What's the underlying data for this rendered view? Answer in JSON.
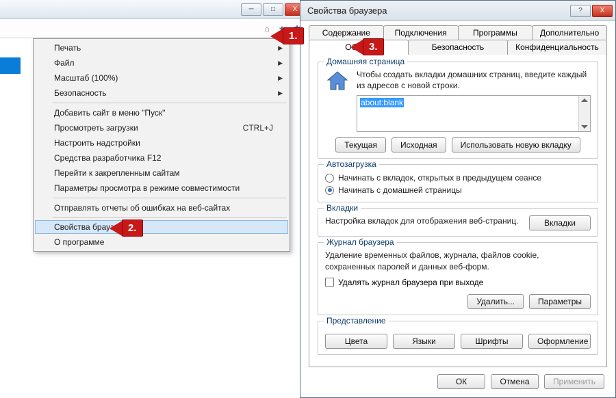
{
  "browser": {
    "icons": {
      "home": "⌂",
      "star": "★",
      "gear": "✱"
    },
    "win": {
      "min": "─",
      "max": "□",
      "close": "X"
    }
  },
  "menu": {
    "print": "Печать",
    "file": "Файл",
    "zoom": "Масштаб (100%)",
    "safety": "Безопасность",
    "add_start": "Добавить сайт в меню \"Пуск\"",
    "downloads": "Просмотреть загрузки",
    "downloads_sc": "CTRL+J",
    "addons": "Настроить надстройки",
    "f12": "Средства разработчика F12",
    "pinned": "Перейти к закрепленным сайтам",
    "compat": "Параметры просмотра в режиме совместимости",
    "errors": "Отправлять отчеты об ошибках на веб-сайтах",
    "props": "Свойства браузера",
    "about": "О программе"
  },
  "dialog": {
    "title": "Свойства браузера",
    "tabs_row1": {
      "content": "Содержание",
      "connections": "Подключения",
      "programs": "Программы",
      "advanced": "Дополнительно"
    },
    "tabs_row2": {
      "general": "Общие",
      "security": "Безопасность",
      "privacy": "Конфиденциальность"
    },
    "homepage": {
      "legend": "Домашняя страница",
      "text": "Чтобы создать вкладки домашних страниц, введите каждый из адресов с новой строки.",
      "url": "about:blank",
      "btn_current": "Текущая",
      "btn_default": "Исходная",
      "btn_newtab": "Использовать новую вкладку"
    },
    "startup": {
      "legend": "Автозагрузка",
      "opt_last": "Начинать с вкладок, открытых в предыдущем сеансе",
      "opt_home": "Начинать с домашней страницы"
    },
    "tabsgroup": {
      "legend": "Вкладки",
      "text": "Настройка вкладок для отображения веб-страниц.",
      "btn": "Вкладки"
    },
    "history": {
      "legend": "Журнал браузера",
      "text": "Удаление временных файлов, журнала, файлов cookie, сохраненных паролей и данных веб-форм.",
      "chk": "Удалять журнал браузера при выходе",
      "btn_delete": "Удалить...",
      "btn_params": "Параметры"
    },
    "appearance": {
      "legend": "Представление",
      "btn_colors": "Цвета",
      "btn_lang": "Языки",
      "btn_fonts": "Шрифты",
      "btn_style": "Оформление"
    },
    "footer": {
      "ok": "ОК",
      "cancel": "Отмена",
      "apply": "Применить"
    }
  },
  "markers": {
    "m1": "1.",
    "m2": "2.",
    "m3": "3."
  }
}
